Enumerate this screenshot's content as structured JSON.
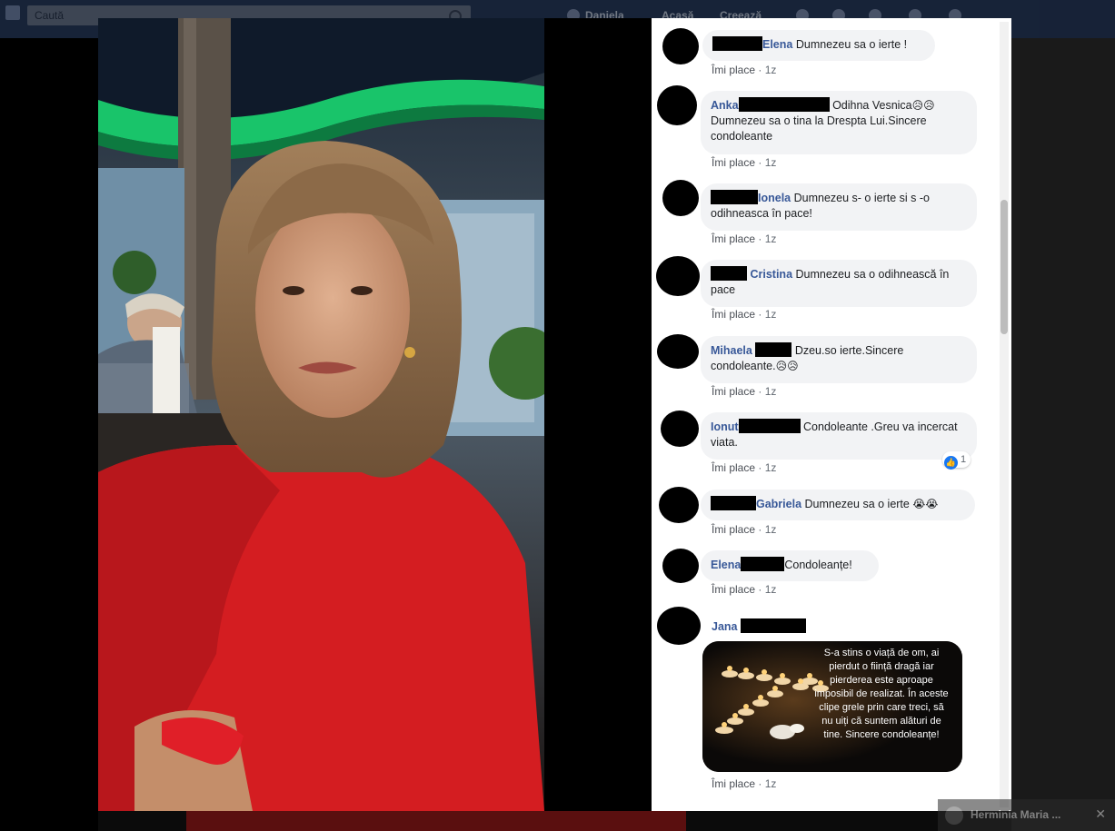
{
  "topbar": {
    "search_placeholder": "Caută",
    "nav_profile": "Daniela",
    "nav_home": "Acasă",
    "nav_create": "Creează"
  },
  "comments": [
    {
      "author": "Elena",
      "text": "Dumnezeu sa o ierte !",
      "like": "Îmi place",
      "time": "1z"
    },
    {
      "author": "Anka",
      "text_line1": "Odihna Vesnica",
      "text_rest": "Dumnezeu sa o tina la Drespta Lui.Sincere condoleante",
      "emoji": "😥😥",
      "like": "Îmi place",
      "time": "1z"
    },
    {
      "author": "Ionela",
      "text": "Dumnezeu s- o ierte si s -o odihneasca în pace!",
      "like": "Îmi place",
      "time": "1z"
    },
    {
      "author": "Cristina",
      "text": "Dumnezeu sa o odihnească în pace",
      "like": "Îmi place",
      "time": "1z"
    },
    {
      "author": "Mihaela",
      "text": "Dzeu.so ierte.Sincere condoleante.",
      "emoji": "😥😥",
      "like": "Îmi place",
      "time": "1z"
    },
    {
      "author": "Ionut",
      "text": "Condoleante .Greu va incercat viata.",
      "like": "Îmi place",
      "time": "1z",
      "reactions": "1"
    },
    {
      "author": "Gabriela",
      "text": "Dumnezeu sa o ierte",
      "emoji": "😭😭",
      "like": "Îmi place",
      "time": "1z"
    },
    {
      "author": "Elena",
      "text": "Condoleanțe!",
      "like": "Îmi place",
      "time": "1z"
    },
    {
      "author": "Jana",
      "like": "Îmi place",
      "time": "1z",
      "image_text": "S-a stins o viață de om, ai pierdut o ființă dragă iar pierderea este aproape imposibil de realizat. În aceste clipe grele prin care treci, să nu uiți că suntem alături de tine. Sincere condoleanțe!"
    }
  ],
  "bottom_tab": {
    "label": "Herminia Maria ..."
  },
  "colors": {
    "author": "#385898",
    "bubble": "#f2f3f5",
    "meta": "#606770",
    "topbar": "#22375d"
  }
}
